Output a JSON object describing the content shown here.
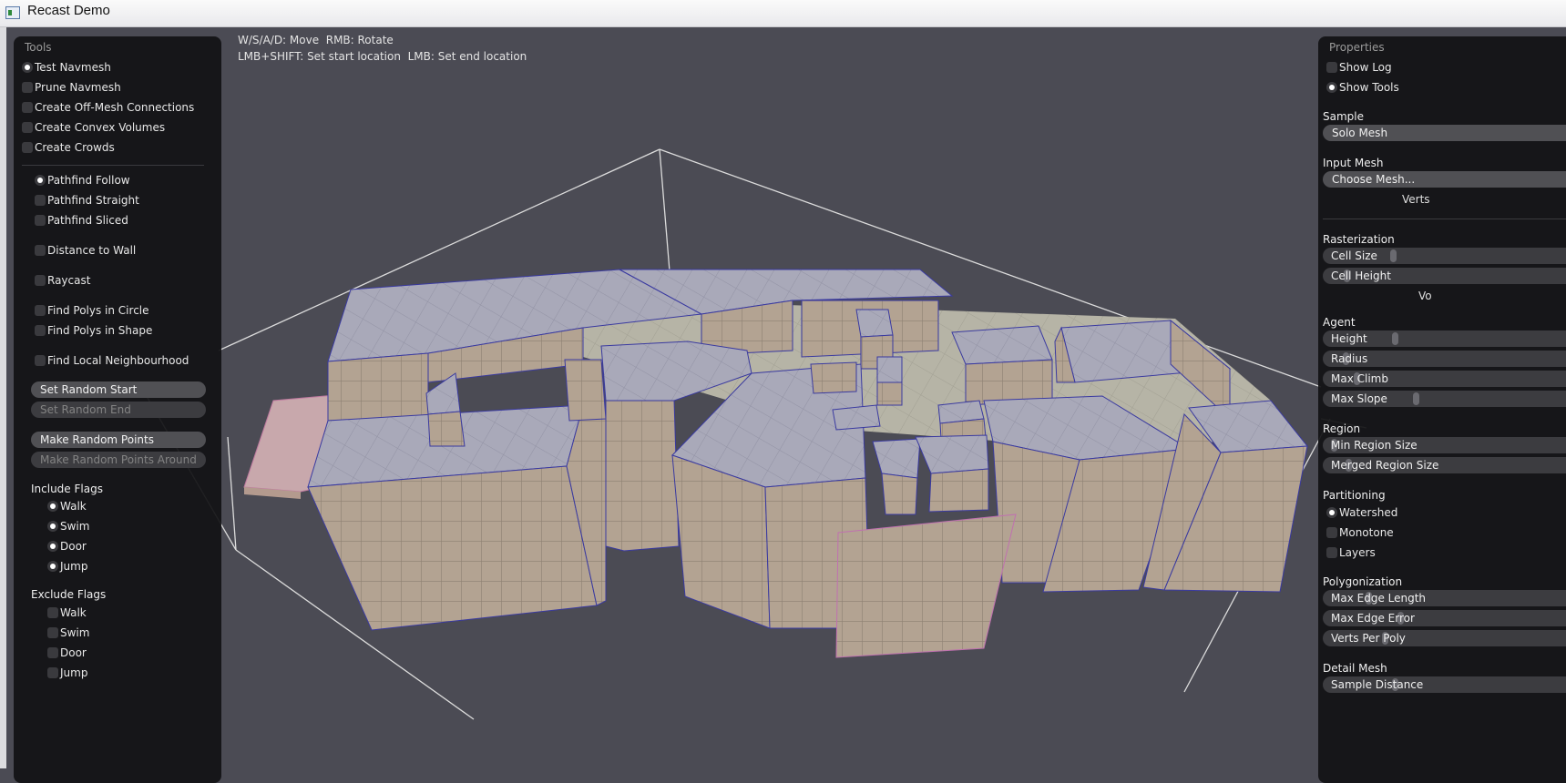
{
  "window": {
    "title": "Recast Demo"
  },
  "hints": {
    "line1": "W/S/A/D: Move  RMB: Rotate",
    "line2": "LMB+SHIFT: Set start location  LMB: Set end location"
  },
  "tools": {
    "title": "Tools",
    "modes": [
      {
        "label": "Test Navmesh",
        "selected": true
      },
      {
        "label": "Prune Navmesh",
        "selected": false
      },
      {
        "label": "Create Off-Mesh Connections",
        "selected": false
      },
      {
        "label": "Create Convex Volumes",
        "selected": false
      },
      {
        "label": "Create Crowds",
        "selected": false
      }
    ],
    "test_options": [
      {
        "label": "Pathfind Follow",
        "selected": true
      },
      {
        "label": "Pathfind Straight",
        "selected": false
      },
      {
        "label": "Pathfind Sliced",
        "selected": false
      },
      {
        "label": "Distance to Wall",
        "selected": false
      },
      {
        "label": "Raycast",
        "selected": false
      },
      {
        "label": "Find Polys in Circle",
        "selected": false
      },
      {
        "label": "Find Polys in Shape",
        "selected": false
      },
      {
        "label": "Find Local Neighbourhood",
        "selected": false
      }
    ],
    "buttons": [
      {
        "label": "Set Random Start",
        "enabled": true
      },
      {
        "label": "Set Random End",
        "enabled": false
      },
      {
        "label": "Make Random Points",
        "enabled": true
      },
      {
        "label": "Make Random Points Around",
        "enabled": false
      }
    ],
    "include_flags": {
      "title": "Include Flags",
      "items": [
        {
          "label": "Walk",
          "checked": true
        },
        {
          "label": "Swim",
          "checked": true
        },
        {
          "label": "Door",
          "checked": true
        },
        {
          "label": "Jump",
          "checked": true
        }
      ]
    },
    "exclude_flags": {
      "title": "Exclude Flags",
      "items": [
        {
          "label": "Walk",
          "checked": false
        },
        {
          "label": "Swim",
          "checked": false
        },
        {
          "label": "Door",
          "checked": false
        },
        {
          "label": "Jump",
          "checked": false
        }
      ]
    }
  },
  "properties": {
    "title": "Properties",
    "show_log": {
      "label": "Show Log",
      "checked": false
    },
    "show_tools": {
      "label": "Show Tools",
      "checked": true
    },
    "sample": {
      "title": "Sample",
      "value": "Solo Mesh"
    },
    "input_mesh": {
      "title": "Input Mesh",
      "button": "Choose Mesh...",
      "verts": "Verts"
    },
    "rasterization": {
      "title": "Rasterization",
      "sliders": [
        {
          "label": "Cell Size",
          "value": 0.3
        },
        {
          "label": "Cell Height",
          "value": 0.2
        }
      ],
      "voxels": "Vo"
    },
    "agent": {
      "title": "Agent",
      "sliders": [
        {
          "label": "Height",
          "value": 2.0
        },
        {
          "label": "Radius",
          "value": 0.6
        },
        {
          "label": "Max Climb",
          "value": 0.9
        },
        {
          "label": "Max Slope",
          "value": 45
        }
      ]
    },
    "region": {
      "title": "Region",
      "sliders": [
        {
          "label": "Min Region Size",
          "value": 8
        },
        {
          "label": "Merged Region Size",
          "value": 20
        }
      ]
    },
    "partitioning": {
      "title": "Partitioning",
      "options": [
        {
          "label": "Watershed",
          "selected": true
        },
        {
          "label": "Monotone",
          "selected": false
        },
        {
          "label": "Layers",
          "selected": false
        }
      ]
    },
    "polygonization": {
      "title": "Polygonization",
      "sliders": [
        {
          "label": "Max Edge Length",
          "value": 12
        },
        {
          "label": "Max Edge Error",
          "value": 1.3
        },
        {
          "label": "Verts Per Poly",
          "value": 6
        }
      ]
    },
    "detail_mesh": {
      "title": "Detail Mesh",
      "sliders": [
        {
          "label": "Sample Distance",
          "value": 6
        }
      ]
    }
  },
  "colors": {
    "background": "#4b4b54",
    "panel": "#121214",
    "wall": "#b3a392",
    "top": "#a6a6b6",
    "edge": "#3a3aa0",
    "offmesh": "#c8a8ac"
  }
}
